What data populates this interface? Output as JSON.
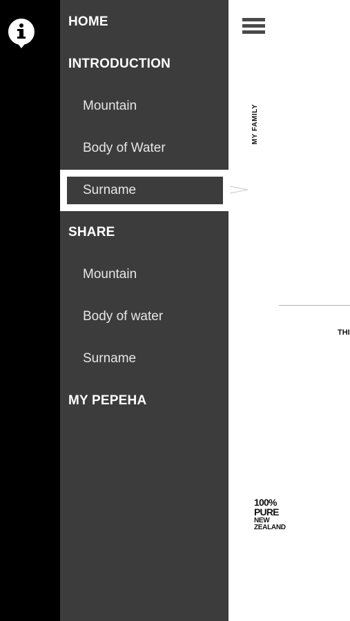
{
  "menu": {
    "home": "HOME",
    "introduction": {
      "label": "INTRODUCTION",
      "items": [
        "Mountain",
        "Body of Water",
        "Surname"
      ]
    },
    "share": {
      "label": "SHARE",
      "items": [
        "Mountain",
        "Body of water",
        "Surname"
      ]
    },
    "my_pepeha": "MY PEPEHA",
    "selected_item": "Surname"
  },
  "content": {
    "vertical_label": "MY FAMILY",
    "clipped_text": "THI",
    "logo_line1": "100% PURE",
    "logo_line2": "NEW ZEALAND"
  },
  "icons": {
    "info": "info-icon",
    "hamburger": "hamburger-menu-icon",
    "selection_pointer": "pointer-arrow-icon"
  },
  "colors": {
    "rail": "#000000",
    "panel": "#3c3c3c",
    "menu_text": "#ffffff",
    "highlight_frame": "#ffffff"
  }
}
